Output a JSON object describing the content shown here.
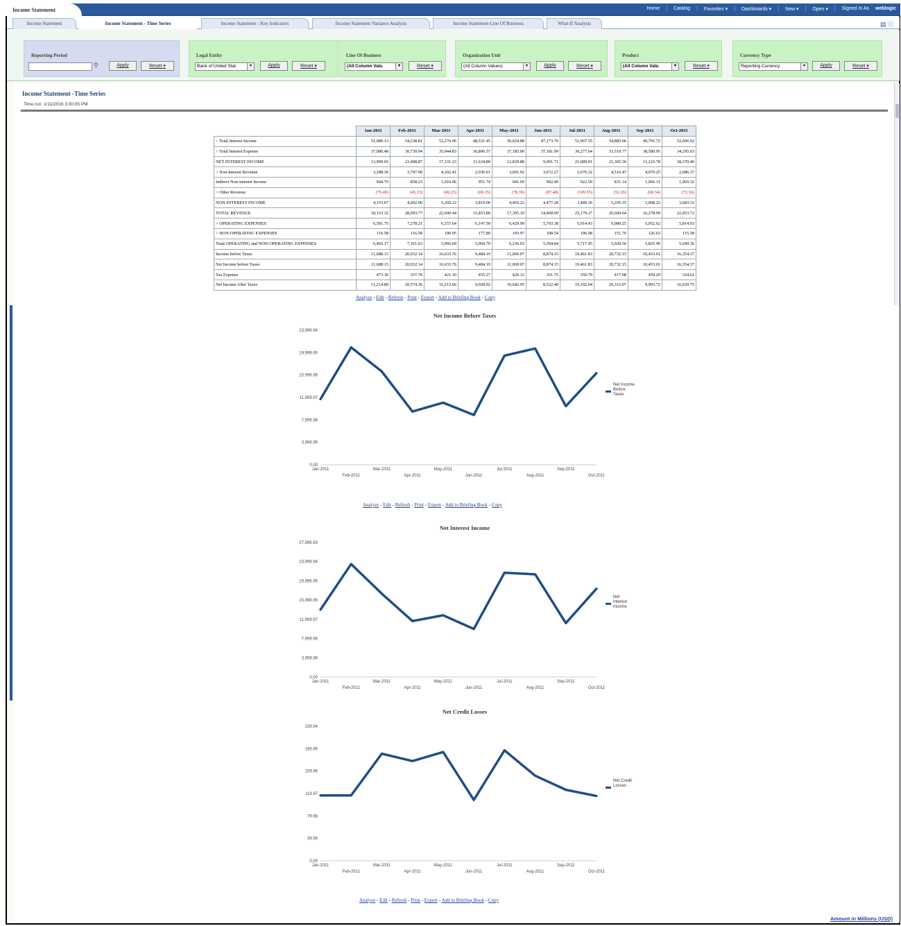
{
  "app": {
    "title": "Income Statement",
    "nav": [
      "Home",
      "Catalog",
      "Favorites ▾",
      "Dashboards ▾",
      "New ▾",
      "Open ▾",
      "Signed In As",
      "weblogic"
    ]
  },
  "tabs": [
    "Income Statement",
    "Income Statement - Time Series",
    "Income Statement - Key Indicators",
    "Income Statement Variance Analysis",
    "Income Statement-Line Of Business",
    "What-If Analysis"
  ],
  "prompts": {
    "reporting_period": {
      "label": "Reporting Period",
      "value": "",
      "apply": "Apply",
      "reset": "Reset ▾"
    },
    "legal_entity": {
      "label": "Legal Entity",
      "value": "Bank of United Stat",
      "apply": "Apply",
      "reset": "Reset ▾"
    },
    "line_of_business": {
      "label": "Line Of Business",
      "value": "(All Column Valu",
      "apply": "Apply",
      "reset": "Reset ▾"
    },
    "organization_unit": {
      "label": "Organization Unit",
      "value": "(All Column Values)",
      "apply": "Apply",
      "reset": "Reset ▾"
    },
    "product": {
      "label": "Product",
      "value": "(All Column Valu",
      "apply": "Apply",
      "reset": "Reset ▾"
    },
    "currency_type": {
      "label": "Currency Type",
      "value": "Reporting Currency",
      "apply": "Apply",
      "reset": "Reset ▾"
    }
  },
  "report": {
    "title": "Income Statement -Time Series",
    "time_run": "Time run: 1/11/2016 3:30:05 PM"
  },
  "table": {
    "columns": [
      "Jan-2011",
      "Feb-2011",
      "Mar-2011",
      "Apr-2011",
      "May-2011",
      "Jun-2011",
      "Jul-2011",
      "Aug-2011",
      "Sep-2011",
      "Oct-2011"
    ],
    "rows": [
      {
        "label": "> Total Interest Income",
        "values": [
          "51,080.13",
          "54,238.81",
          "53,276.06",
          "48,531.45",
          "50,024.88",
          "47,173.70",
          "51,967.55",
          "54,885.06",
          "49,791.72",
          "52,666.02"
        ]
      },
      {
        "label": "> Total Interest Expense",
        "values": [
          "37,080.48",
          "30,739.94",
          "35,944.83",
          "36,896.57",
          "37,185.00",
          "37,181.99",
          "30,277.64",
          "33,519.77",
          "38,580.95",
          "34,295.63"
        ]
      },
      {
        "label": "NET INTEREST INCOME",
        "values": [
          "13,999.65",
          "23,498.87",
          "17,331.23",
          "11,634.89",
          "12,839.88",
          "9,991.71",
          "21,689.91",
          "21,365.30",
          "11,210.78",
          "18,370.40"
        ]
      },
      {
        "label": "> Non-Interest Revenue",
        "values": [
          "3,288.36",
          "3,797.90",
          "4,302.41",
          "2,936.61",
          "3,601.92",
          "3,672.27",
          "2,676.32",
          "4,516.47",
          "4,070.25",
          "2,686.37"
        ]
      },
      {
        "label": "Indirect Non-interest Income",
        "values": [
          "944.70",
          "858.23",
          "1,016.06",
          "951.74",
          "941.69",
          "902.49",
          "922.59",
          "831.14",
          "1,066.31",
          "1,069.32"
        ]
      },
      {
        "label": "> Other Revenue",
        "neg": true,
        "values": [
          "(79.40)",
          "(45.23)",
          "(49.25)",
          "(69.35)",
          "(78.39)",
          "(97.48)",
          "(109.55)",
          "(52.26)",
          "(68.34)",
          "(72.36)"
        ]
      },
      {
        "label": "NON-INTEREST INCOME",
        "values": [
          "4,153.67",
          "4,602.90",
          "5,269.22",
          "3,819.00",
          "4,465.22",
          "4,477.28",
          "3,489.36",
          "5,295.35",
          "5,068.22",
          "3,683.33"
        ]
      },
      {
        "label": "TOTAL REVENUE",
        "values": [
          "18,153.32",
          "28,093.77",
          "22,600.44",
          "15,453.89",
          "17,305.10",
          "14,468.99",
          "25,179.27",
          "26,660.64",
          "16,278.99",
          "22,053.72"
        ]
      },
      {
        "label": "> OPERATING EXPENSES",
        "values": [
          "6,581.75",
          "7,278.21",
          "6,157.64",
          "6,147.59",
          "6,429.99",
          "5,703.38",
          "5,914.43",
          "6,080.25",
          "5,952.62",
          "5,814.93"
        ]
      },
      {
        "label": "> NON-OPERATING EXPENSES",
        "values": [
          "116.58",
          "116.58",
          "190.95",
          "177.89",
          "193.97",
          "108.54",
          "196.98",
          "151.76",
          "126.63",
          "115.58"
        ]
      },
      {
        "label": "Total OPERATING and NON-OPERATING EXPENSES",
        "values": [
          "6,465.17",
          "7,161.63",
          "5,966.69",
          "5,969.70",
          "6,236.03",
          "5,594.84",
          "5,717.45",
          "5,928.50",
          "5,825.99",
          "5,699.36"
        ]
      },
      {
        "label": "Income before Taxes",
        "values": [
          "11,688.15",
          "20,932.14",
          "16,633.76",
          "9,484.19",
          "11,069.07",
          "8,874.15",
          "19,461.83",
          "20,732.15",
          "10,453.01",
          "16,354.37"
        ]
      },
      {
        "label": "Net Income before Taxes",
        "values": [
          "11,688.15",
          "20,932.14",
          "16,633.76",
          "9,484.19",
          "11,069.07",
          "8,874.15",
          "19,461.83",
          "20,732.15",
          "10,453.01",
          "16,354.37"
        ]
      },
      {
        "label": "Tax Expense",
        "values": [
          "473.36",
          "357.78",
          "421.10",
          "455.27",
          "426.12",
          "351.75",
          "359.79",
          "417.08",
          "459.29",
          "324.62"
        ]
      },
      {
        "label": "Net Income After Taxes",
        "values": [
          "11,214.80",
          "20,574.36",
          "16,212.66",
          "9,028.92",
          "10,642.95",
          "8,522.40",
          "19,102.04",
          "20,315.07",
          "9,993.72",
          "16,029.75"
        ]
      }
    ]
  },
  "links": [
    "Analyze",
    "Edit",
    "Refresh",
    "Print",
    "Export",
    "Add to Briefing Book",
    "Copy"
  ],
  "chart_data": [
    {
      "type": "line",
      "title": "Net Income Before Taxes",
      "x": [
        "Jan-2011",
        "Feb-2011",
        "Mar-2011",
        "Apr-2011",
        "May-2011",
        "Jun-2011",
        "Jul-2011",
        "Aug-2011",
        "Sep-2011",
        "Oct-2011"
      ],
      "series": [
        {
          "name": "Net Income Before Taxes",
          "values": [
            11688.15,
            20932.14,
            16633.76,
            9484.19,
            11069.07,
            8874.15,
            19461.83,
            20732.15,
            10453.01,
            16354.37
          ]
        }
      ],
      "yticks": [
        "23,999.94",
        "19,999.95",
        "15,999.96",
        "11,999.97",
        "7,999.98",
        "3,999.99",
        "0.00"
      ],
      "ylim": [
        0,
        23999.94
      ],
      "legend": "right",
      "color": "#1f4e84"
    },
    {
      "type": "line",
      "title": "Net Interest Income",
      "x": [
        "Jan-2011",
        "Feb-2011",
        "Mar-2011",
        "Apr-2011",
        "May-2011",
        "Jun-2011",
        "Jul-2011",
        "Aug-2011",
        "Sep-2011",
        "Oct-2011"
      ],
      "series": [
        {
          "name": "Net Interest Income",
          "values": [
            13999.65,
            23498.87,
            17331.23,
            11634.89,
            12839.88,
            9991.71,
            21689.91,
            21365.3,
            11210.78,
            18370.4
          ]
        }
      ],
      "yticks": [
        "27,999.93",
        "23,999.94",
        "19,999.95",
        "15,999.96",
        "11,999.97",
        "7,999.98",
        "3,999.99",
        "0.00"
      ],
      "ylim": [
        0,
        27999.93
      ],
      "legend": "right",
      "color": "#1f4e84"
    },
    {
      "type": "line",
      "title": "Net Credit Losses",
      "x": [
        "Jan-2011",
        "Feb-2011",
        "Mar-2011",
        "Apr-2011",
        "May-2011",
        "Jun-2011",
        "Jul-2011",
        "Aug-2011",
        "Sep-2011",
        "Oct-2011"
      ],
      "series": [
        {
          "name": "Net Credit Losses",
          "values": [
            116.58,
            116.58,
            190.95,
            177.89,
            193.97,
            108.54,
            196.98,
            151.76,
            126.63,
            115.58
          ]
        }
      ],
      "yticks": [
        "239.94",
        "199.95",
        "159.96",
        "119.97",
        "79.98",
        "39.99",
        "0.00"
      ],
      "ylim": [
        0,
        239.94
      ],
      "legend": "right",
      "color": "#1f4e84"
    }
  ],
  "footer": "Amount in Millions (USD)"
}
